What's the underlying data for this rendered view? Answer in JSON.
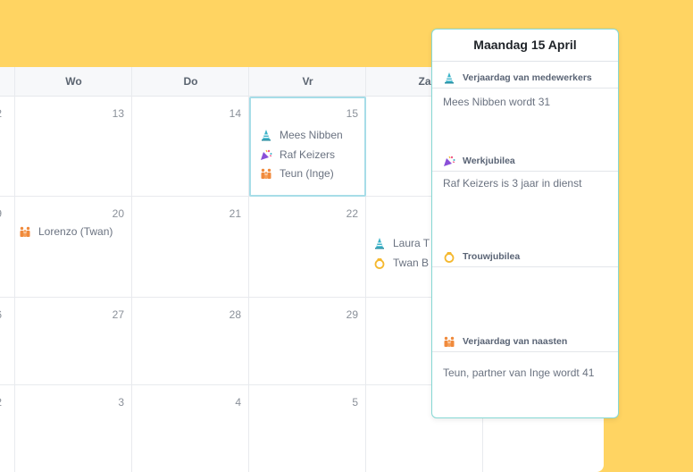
{
  "calendar": {
    "weekdays": [
      "Wo",
      "Do",
      "Vr",
      "Za"
    ],
    "cut_days": [
      "2",
      "9",
      "6",
      "2"
    ],
    "rows": [
      {
        "days": [
          "13",
          "14",
          "15",
          ""
        ]
      },
      {
        "days": [
          "20",
          "21",
          "22",
          ""
        ]
      },
      {
        "days": [
          "27",
          "28",
          "29",
          ""
        ]
      },
      {
        "days": [
          "3",
          "4",
          "5",
          ""
        ]
      }
    ],
    "events": {
      "day15": [
        {
          "icon": "birthday-cone-icon",
          "label": "Mees Nibben"
        },
        {
          "icon": "party-popper-icon",
          "label": "Raf Keizers"
        },
        {
          "icon": "family-icon",
          "label": "Teun (Inge)"
        }
      ],
      "day20": [
        {
          "icon": "family-icon",
          "label": "Lorenzo (Twan)"
        }
      ],
      "za_row2": [
        {
          "icon": "birthday-cone-icon",
          "label": "Laura T"
        },
        {
          "icon": "ring-icon",
          "label": "Twan B"
        }
      ]
    }
  },
  "popover": {
    "title": "Maandag 15 April",
    "sections": [
      {
        "icon": "birthday-cone-icon",
        "heading": "Verjaardag van medewerkers",
        "text": "Mees Nibben wordt 31"
      },
      {
        "icon": "party-popper-icon",
        "heading": "Werkjubilea",
        "text": "Raf Keizers is 3 jaar in dienst"
      },
      {
        "icon": "ring-icon",
        "heading": "Trouwjubilea",
        "text": ""
      },
      {
        "icon": "family-icon",
        "heading": "Verjaardag van naasten",
        "text": "Teun, partner van Inge wordt 41"
      }
    ]
  },
  "colors": {
    "background": "#FFD462",
    "today_border": "#a7dde8",
    "popover_border": "#86d8d4",
    "cone": "#3bb3c9",
    "party": "#8a4fd8",
    "family": "#f08a3c",
    "ring": "#f5b82e"
  }
}
